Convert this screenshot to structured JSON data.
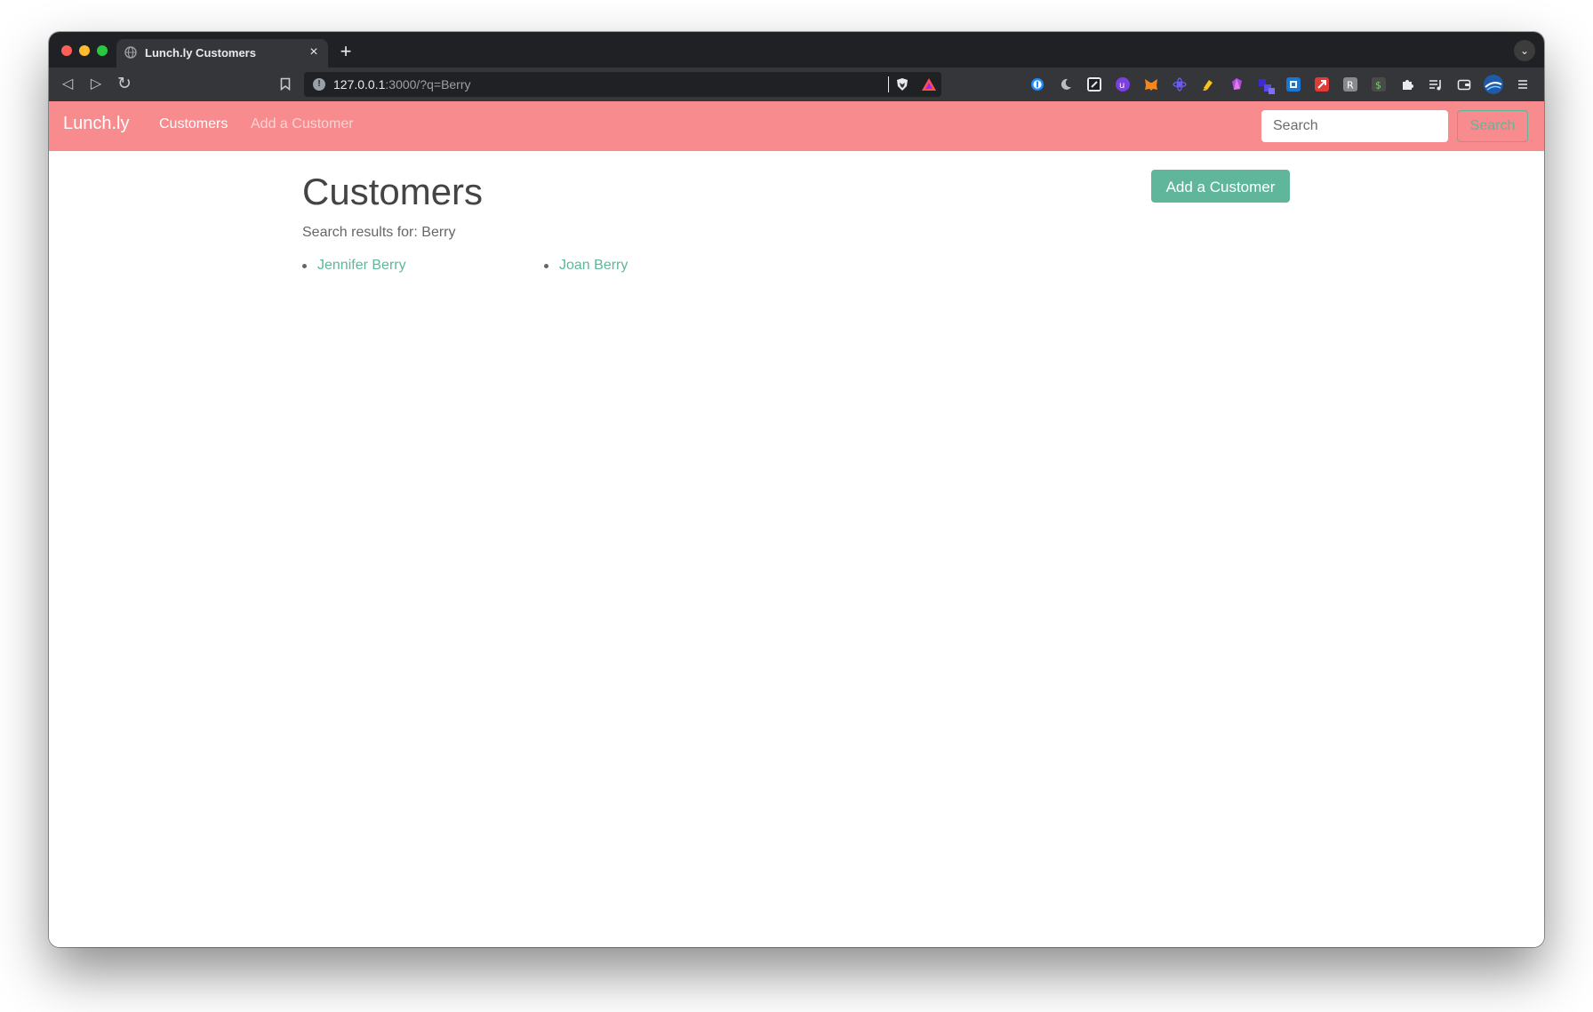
{
  "browser": {
    "tab": {
      "title": "Lunch.ly Customers",
      "close_glyph": "×"
    },
    "new_tab_glyph": "+",
    "tab_menu_glyph": "⌄",
    "address": {
      "host": "127.0.0.1",
      "path": ":3000/?q=Berry"
    },
    "nav": {
      "back_glyph": "◁",
      "forward_glyph": "▷",
      "reload_glyph": "↻"
    },
    "extension_icons": [
      "password-manager-icon",
      "moon-icon",
      "edit-icon",
      "ublock-icon",
      "metamask-icon",
      "atom-icon",
      "highlighter-icon",
      "gem-icon",
      "blocks-icon",
      "id-icon",
      "arrow-icon",
      "r-icon",
      "dollar-icon",
      "puzzle-icon",
      "playlist-icon",
      "wallet-icon",
      "profile-avatar-icon",
      "menu-icon"
    ]
  },
  "navbar": {
    "brand": "Lunch.ly",
    "links": [
      {
        "label": "Customers",
        "active": true
      },
      {
        "label": "Add a Customer",
        "active": false
      }
    ],
    "search": {
      "placeholder": "Search",
      "value": "",
      "button_label": "Search"
    }
  },
  "main": {
    "title": "Customers",
    "add_button_label": "Add a Customer",
    "results_label": "Search results for: Berry",
    "results": [
      "Jennifer Berry",
      "Joan Berry"
    ]
  },
  "colors": {
    "navbar_bg": "#f78b8e",
    "accent": "#5fb69a",
    "heading": "#444444",
    "text_muted": "#666666",
    "browser_chrome": "#35363a"
  }
}
